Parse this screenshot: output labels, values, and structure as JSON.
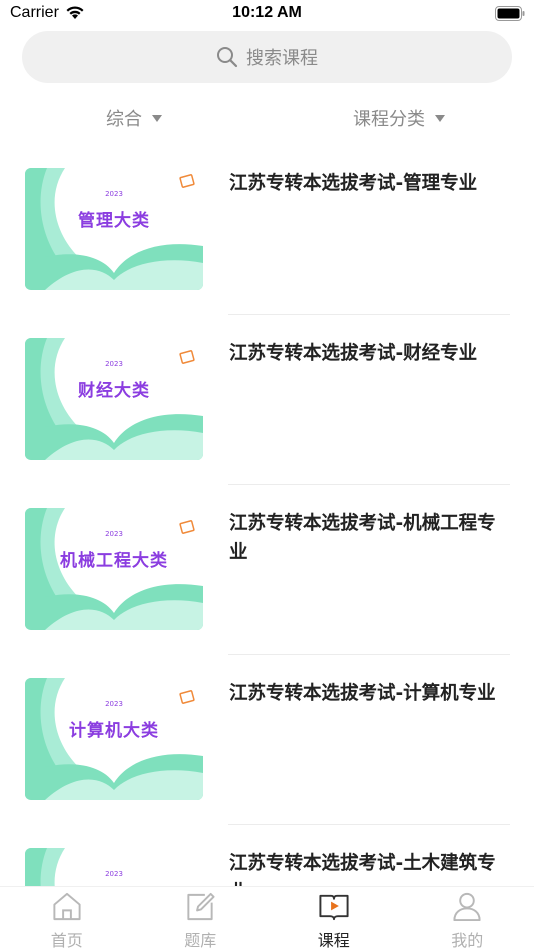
{
  "status": {
    "carrier": "Carrier",
    "time": "10:12 AM"
  },
  "search": {
    "placeholder": "搜索课程"
  },
  "filters": {
    "sort_label": "综合",
    "category_label": "课程分类"
  },
  "courses": [
    {
      "title": "江苏专转本选拔考试-管理专业",
      "thumb_year": "2023",
      "thumb_title": "管理大类"
    },
    {
      "title": "江苏专转本选拔考试-财经专业",
      "thumb_year": "2023",
      "thumb_title": "财经大类"
    },
    {
      "title": "江苏专转本选拔考试-机械工程专业",
      "thumb_year": "2023",
      "thumb_title": "机械工程大类"
    },
    {
      "title": "江苏专转本选拔考试-计算机专业",
      "thumb_year": "2023",
      "thumb_title": "计算机大类"
    },
    {
      "title": "江苏专转本选拔考试-土木建筑专业",
      "thumb_year": "2023",
      "thumb_title": ""
    }
  ],
  "tabs": [
    {
      "label": "首页",
      "icon": "home-icon",
      "active": false
    },
    {
      "label": "题库",
      "icon": "edit-icon",
      "active": false
    },
    {
      "label": "课程",
      "icon": "course-icon",
      "active": true
    },
    {
      "label": "我的",
      "icon": "user-icon",
      "active": false
    }
  ],
  "colors": {
    "accent": "#e8721c",
    "thumb_green": "#7fe0bd",
    "thumb_purple": "#8b3de0"
  }
}
